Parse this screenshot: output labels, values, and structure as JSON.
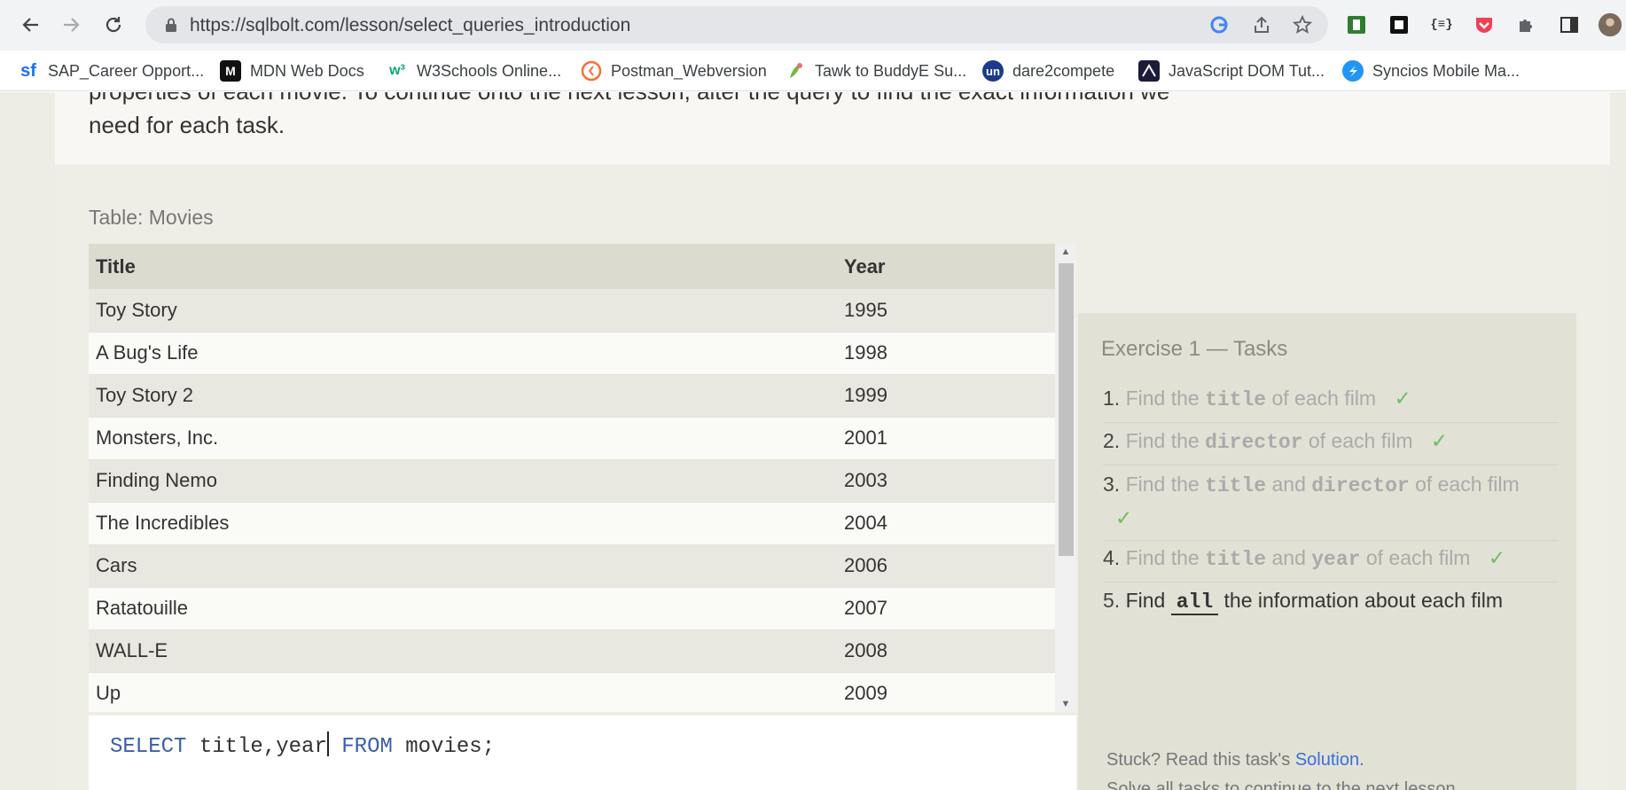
{
  "browser": {
    "url": "https://sqlbolt.com/lesson/select_queries_introduction",
    "bookmarks": [
      {
        "label": "SAP_Career Opport...",
        "icon": "sf"
      },
      {
        "label": "MDN Web Docs",
        "icon": "M"
      },
      {
        "label": "W3Schools Online...",
        "icon": "w3"
      },
      {
        "label": "Postman_Webversion",
        "icon": "postman"
      },
      {
        "label": "Tawk to BuddyE Su...",
        "icon": "tawk"
      },
      {
        "label": "dare2compete",
        "icon": "un"
      },
      {
        "label": "JavaScript DOM Tut...",
        "icon": "js"
      },
      {
        "label": "Syncios Mobile Ma...",
        "icon": "syncios"
      }
    ]
  },
  "lesson": {
    "intro_line1": "properties of each movie. To continue onto the next lesson, alter the query to find the exact information we",
    "intro_line2": "need for each task.",
    "table_caption": "Table: Movies",
    "table": {
      "headers": [
        "Title",
        "Year"
      ],
      "rows": [
        [
          "Toy Story",
          "1995"
        ],
        [
          "A Bug's Life",
          "1998"
        ],
        [
          "Toy Story 2",
          "1999"
        ],
        [
          "Monsters, Inc.",
          "2001"
        ],
        [
          "Finding Nemo",
          "2003"
        ],
        [
          "The Incredibles",
          "2004"
        ],
        [
          "Cars",
          "2006"
        ],
        [
          "Ratatouille",
          "2007"
        ],
        [
          "WALL-E",
          "2008"
        ],
        [
          "Up",
          "2009"
        ]
      ]
    },
    "editor": {
      "kw_select": "SELECT",
      "columns": " title,year",
      "kw_from": "FROM",
      "rest": " movies;"
    },
    "exercise": {
      "title": "Exercise 1 — Tasks",
      "check": "✓",
      "tasks": [
        {
          "num": "1.",
          "parts": [
            "Find the ",
            "title",
            " of each film"
          ],
          "done": true
        },
        {
          "num": "2.",
          "parts": [
            "Find the ",
            "director",
            " of each film"
          ],
          "done": true
        },
        {
          "num": "3.",
          "parts": [
            "Find the ",
            "title",
            " and ",
            "director",
            " of each film"
          ],
          "done": true
        },
        {
          "num": "4.",
          "parts": [
            "Find the ",
            "title",
            " and ",
            "year",
            " of each film"
          ],
          "done": true
        },
        {
          "num": "5.",
          "parts": [
            "Find ",
            "all",
            " the information about each film"
          ],
          "done": false
        }
      ],
      "stuck_text": "Stuck? Read this task's ",
      "solution_link": "Solution.",
      "clip_text": "Solve all tasks to continue to the next lesson."
    }
  },
  "colors": {
    "accent_link": "#3a6fd8",
    "check_green": "#6abf62",
    "keyword_blue": "#3a5fa8"
  }
}
